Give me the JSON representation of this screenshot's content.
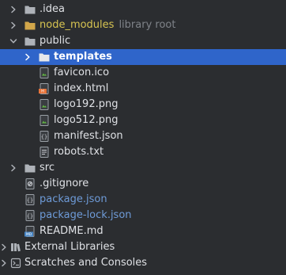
{
  "tree": {
    "idea": {
      "label": ".idea"
    },
    "node_modules": {
      "label": "node_modules",
      "hint": "library root"
    },
    "public": {
      "label": "public"
    },
    "templates": {
      "label": "templates"
    },
    "favicon": {
      "label": "favicon.ico"
    },
    "index_html": {
      "label": "index.html"
    },
    "logo192": {
      "label": "logo192.png"
    },
    "logo512": {
      "label": "logo512.png"
    },
    "manifest": {
      "label": "manifest.json"
    },
    "robots": {
      "label": "robots.txt"
    },
    "src": {
      "label": "src"
    },
    "gitignore": {
      "label": ".gitignore"
    },
    "package_json": {
      "label": "package.json"
    },
    "package_lock": {
      "label": "package-lock.json"
    },
    "readme": {
      "label": "README.md",
      "badge": "MD"
    },
    "external_libraries": {
      "label": "External Libraries"
    },
    "scratches": {
      "label": "Scratches and Consoles"
    }
  },
  "colors": {
    "background": "#2b2d30",
    "selection": "#2f65ca",
    "text": "#dfe1e5",
    "vcs_modified_blue": "#6e9bd8",
    "excluded_yellow": "#d7c451"
  },
  "icons": {
    "idea": "folder-icon",
    "node_modules": "excluded-folder-icon",
    "public": "folder-icon",
    "templates": "folder-icon",
    "favicon": "image-file-icon",
    "index_html": "html-file-icon",
    "logo192": "image-file-icon",
    "logo512": "image-file-icon",
    "manifest": "json-file-icon",
    "robots": "text-file-icon",
    "src": "folder-icon",
    "gitignore": "gitignore-file-icon",
    "package_json": "json-file-icon",
    "package_lock": "json-file-icon",
    "readme": "markdown-file-icon",
    "external_libraries": "library-icon",
    "scratches": "scratches-icon"
  }
}
